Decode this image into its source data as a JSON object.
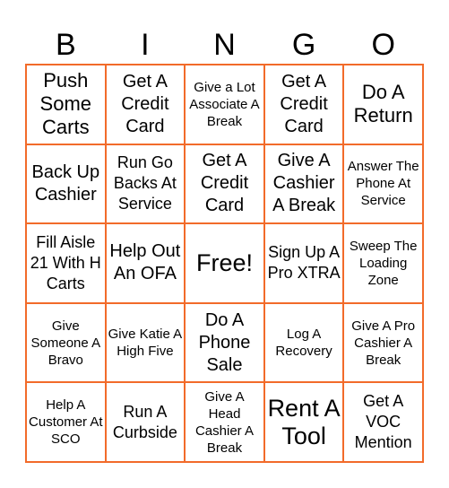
{
  "header": {
    "letters": [
      "B",
      "I",
      "N",
      "G",
      "O"
    ]
  },
  "theme": {
    "border_color": "#F26B2A",
    "text_color": "#000000",
    "background": "#FFFFFF"
  },
  "board": {
    "rows": [
      [
        {
          "text": "Push Some Carts",
          "size": "l"
        },
        {
          "text": "Get A Credit Card",
          "size": "lm"
        },
        {
          "text": "Give a Lot Associate A Break",
          "size": "s"
        },
        {
          "text": "Get A Credit Card",
          "size": "lm"
        },
        {
          "text": "Do A Return",
          "size": "l"
        }
      ],
      [
        {
          "text": "Back Up Cashier",
          "size": "lm"
        },
        {
          "text": "Run Go Backs At Service",
          "size": "m"
        },
        {
          "text": "Get A Credit Card",
          "size": "lm"
        },
        {
          "text": "Give A Cashier A Break",
          "size": "lm"
        },
        {
          "text": "Answer The Phone At Service",
          "size": "s"
        }
      ],
      [
        {
          "text": "Fill Aisle 21 With H Carts",
          "size": "m"
        },
        {
          "text": "Help Out An OFA",
          "size": "lm"
        },
        {
          "text": "Free!",
          "size": "free"
        },
        {
          "text": "Sign Up A Pro XTRA",
          "size": "m"
        },
        {
          "text": "Sweep The Loading Zone",
          "size": "s"
        }
      ],
      [
        {
          "text": "Give Someone A Bravo",
          "size": "s"
        },
        {
          "text": "Give Katie A High Five",
          "size": "s"
        },
        {
          "text": "Do A Phone Sale",
          "size": "lm"
        },
        {
          "text": "Log A Recovery",
          "size": "s"
        },
        {
          "text": "Give A Pro Cashier A Break",
          "size": "s"
        }
      ],
      [
        {
          "text": "Help A Customer At SCO",
          "size": "s"
        },
        {
          "text": "Run A Curbside",
          "size": "m"
        },
        {
          "text": "Give A Head Cashier A Break",
          "size": "s"
        },
        {
          "text": "Rent A Tool",
          "size": "xl"
        },
        {
          "text": "Get A VOC Mention",
          "size": "m"
        }
      ]
    ]
  }
}
